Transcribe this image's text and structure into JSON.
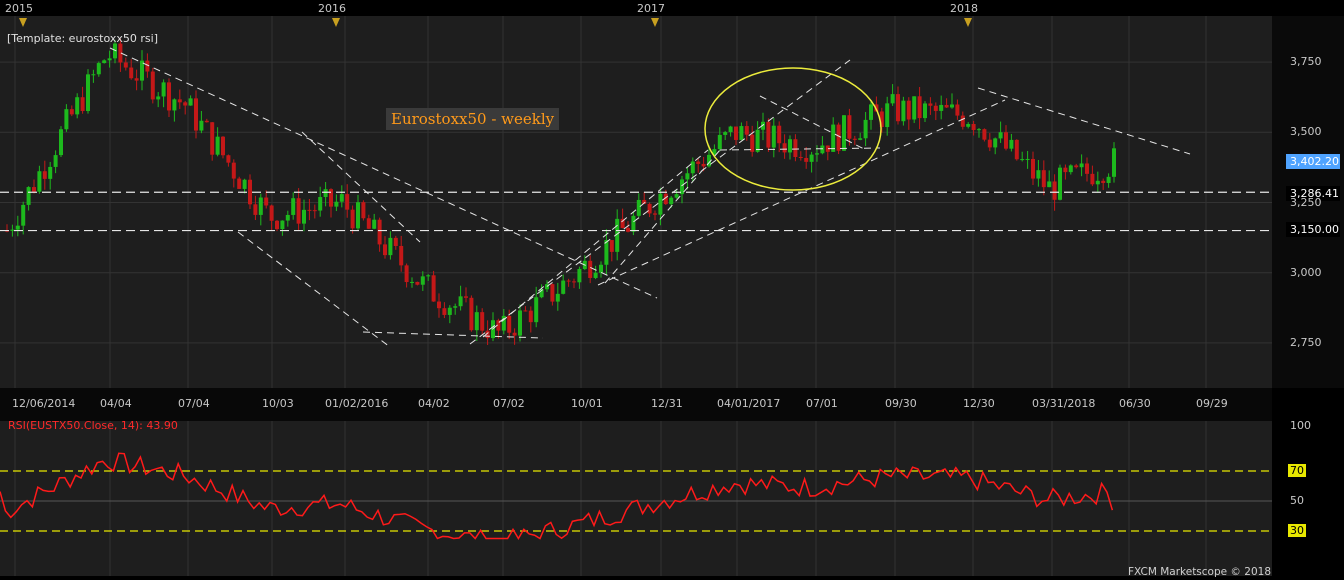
{
  "template_label": "[Template: eurostoxx50 rsi]",
  "title": "Eurostoxx50 - weekly",
  "footer": "FXCM Marketscope © 2018",
  "colors": {
    "background": "#000000",
    "panel": "#1e1e1e",
    "grid": "#333333",
    "bull": "#1db91d",
    "bear": "#c41818",
    "rsi_line": "#ff1a1a",
    "level_line": "#e8e800",
    "dashed_line": "#e6e6e6",
    "circle": "#ecec3c",
    "last_price_bg": "#4fa3ff"
  },
  "years": [
    "2015",
    "2016",
    "2017",
    "2018"
  ],
  "date_labels": [
    "12/06/2014",
    "04/04",
    "07/04",
    "10/03",
    "01/02/2016",
    "04/02",
    "07/02",
    "10/01",
    "12/31",
    "04/01/2017",
    "07/01",
    "09/30",
    "12/30",
    "03/31/2018",
    "06/30",
    "09/29"
  ],
  "price_labels": [
    "3,750",
    "3,500",
    "3,250",
    "3,000",
    "2,750"
  ],
  "price_tags": {
    "last": "3,402.20",
    "support_1": "3,286.41",
    "support_2": "3,150.00"
  },
  "rsi_label": "RSI(EUSTX50.Close, 14): 43.90",
  "rsi_levels": [
    "100",
    "70",
    "50",
    "30"
  ],
  "chart_data": {
    "type": "candlestick",
    "title": "Eurostoxx50 - weekly",
    "y_range": [
      2600,
      3900
    ],
    "horizontal_lines": [
      3286.41,
      3150.0
    ],
    "last_price": 3402.2,
    "key_points": [
      {
        "date": "2014-12-06",
        "close": 3150
      },
      {
        "date": "2015-04-04",
        "close": 3780
      },
      {
        "date": "2015-07-04",
        "close": 3600
      },
      {
        "date": "2015-10-03",
        "close": 3200
      },
      {
        "date": "2016-01-02",
        "close": 3250
      },
      {
        "date": "2016-04-02",
        "close": 2950
      },
      {
        "date": "2016-07-02",
        "close": 2780
      },
      {
        "date": "2016-10-01",
        "close": 3000
      },
      {
        "date": "2016-12-31",
        "close": 3270
      },
      {
        "date": "2017-04-01",
        "close": 3500
      },
      {
        "date": "2017-07-01",
        "close": 3450
      },
      {
        "date": "2017-09-30",
        "close": 3580
      },
      {
        "date": "2017-12-30",
        "close": 3560
      },
      {
        "date": "2018-03-31",
        "close": 3300
      },
      {
        "date": "2018-06-30",
        "close": 3402.2
      }
    ],
    "rsi": {
      "period": 14,
      "last": 43.9,
      "levels": [
        70,
        50,
        30
      ],
      "range": [
        0,
        100
      ]
    }
  }
}
